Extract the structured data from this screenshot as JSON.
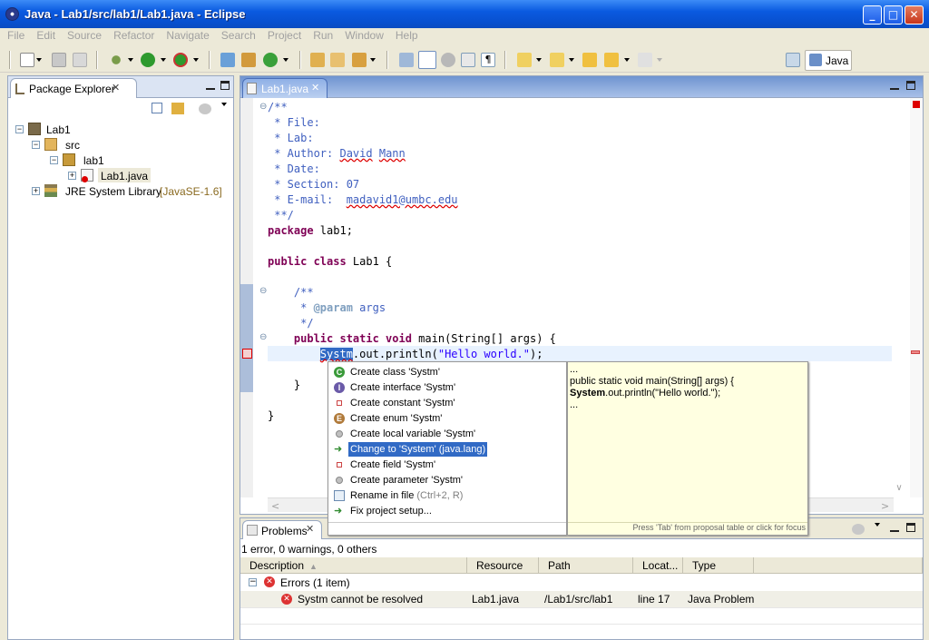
{
  "window": {
    "title": "Java - Lab1/src/lab1/Lab1.java - Eclipse"
  },
  "menu": [
    "File",
    "Edit",
    "Source",
    "Refactor",
    "Navigate",
    "Search",
    "Project",
    "Run",
    "Window",
    "Help"
  ],
  "perspective": {
    "label": "Java"
  },
  "package_explorer": {
    "tab_label": "Package Explorer",
    "tree": [
      {
        "label": "Lab1",
        "icon": "java-project-icon"
      },
      {
        "label": "src",
        "icon": "package-folder-icon"
      },
      {
        "label": "lab1",
        "icon": "package-icon"
      },
      {
        "label": "Lab1.java",
        "icon": "java-file-error-icon"
      },
      {
        "label": "JRE System Library",
        "suffix": "[JavaSE-1.6]",
        "icon": "library-icon"
      }
    ]
  },
  "editor": {
    "tab_label": "Lab1.java",
    "lines": [
      "/**",
      " * File:",
      " * Lab:",
      " * Author: David Mann",
      " * Date:",
      " * Section: 07",
      " * E-mail:  madavid1@umbc.edu",
      " **/",
      "package lab1;",
      "",
      "public class Lab1 {",
      "",
      "    /**",
      "     * @param args",
      "     */",
      "    public static void main(String[] args) {",
      "        Systm.out.println(\"Hello world.\");",
      "",
      "    }",
      "",
      "}"
    ]
  },
  "quick_fix": {
    "proposals": [
      {
        "label": "Create class 'Systm'",
        "icon": "class-icon"
      },
      {
        "label": "Create interface 'Systm'",
        "icon": "interface-icon"
      },
      {
        "label": "Create constant 'Systm'",
        "icon": "constant-icon"
      },
      {
        "label": "Create enum 'Systm'",
        "icon": "enum-icon"
      },
      {
        "label": "Create local variable 'Systm'",
        "icon": "local-variable-icon"
      },
      {
        "label": "Change to 'System' (java.lang)",
        "icon": "change-icon",
        "selected": true
      },
      {
        "label": "Create field 'Systm'",
        "icon": "field-icon"
      },
      {
        "label": "Create parameter 'Systm'",
        "icon": "parameter-icon"
      },
      {
        "label": "Rename in file",
        "shortcut": "(Ctrl+2, R)",
        "icon": "rename-icon"
      },
      {
        "label": "Fix project setup...",
        "icon": "fix-setup-icon"
      }
    ],
    "details": {
      "line1": "...",
      "line2": "public static void main(String[] args) {",
      "line3_bold": "System",
      "line3_rest": ".out.println(\"Hello world.\");",
      "line4": "...",
      "footer": "Press 'Tab' from proposal table or click for focus"
    }
  },
  "problems": {
    "tab_label": "Problems",
    "summary": "1 error, 0 warnings, 0 others",
    "columns": [
      "Description",
      "Resource",
      "Path",
      "Locat...",
      "Type"
    ],
    "group": "Errors (1 item)",
    "rows": [
      {
        "description": "Systm cannot be resolved",
        "resource": "Lab1.java",
        "path": "/Lab1/src/lab1",
        "location": "line 17",
        "type": "Java Problem"
      }
    ]
  }
}
